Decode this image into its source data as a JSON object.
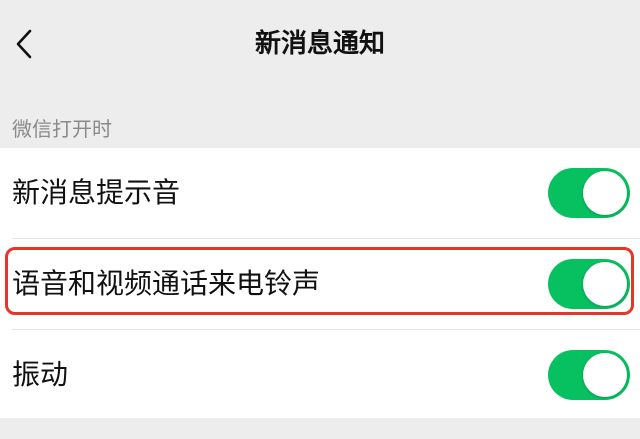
{
  "header": {
    "title": "新消息通知",
    "back_icon": "chevron-left-icon"
  },
  "section": {
    "label": "微信打开时"
  },
  "settings": [
    {
      "label": "新消息提示音",
      "enabled": true
    },
    {
      "label": "语音和视频通话来电铃声",
      "enabled": true
    },
    {
      "label": "振动",
      "enabled": true
    }
  ],
  "colors": {
    "toggle_on": "#07c160",
    "highlight": "#e8352b",
    "background": "#ededed"
  }
}
